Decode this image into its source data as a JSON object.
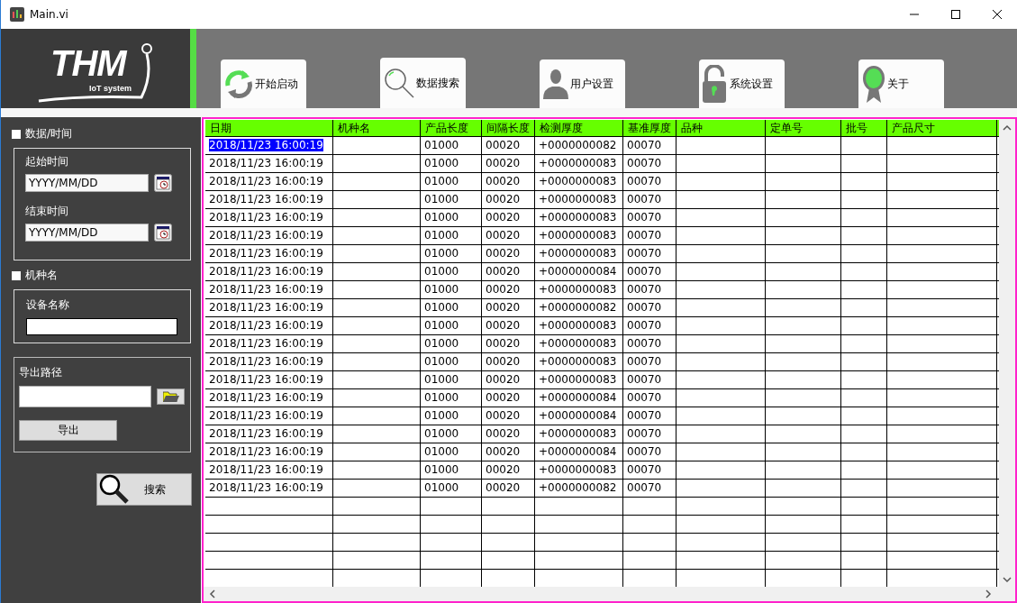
{
  "window": {
    "title": "Main.vi"
  },
  "logo": {
    "name": "THM",
    "tagline": "IoT system"
  },
  "tabs": [
    {
      "label": "开始启动",
      "kind": "refresh",
      "selected": false
    },
    {
      "label": "数据搜索",
      "kind": "search",
      "selected": true
    },
    {
      "label": "用户设置",
      "kind": "user",
      "selected": false
    },
    {
      "label": "系统设置",
      "kind": "lock",
      "selected": false
    },
    {
      "label": "关于",
      "kind": "award",
      "selected": false
    }
  ],
  "filters": {
    "date_filter": {
      "label": "数据/时间",
      "checked": false
    },
    "start_time": {
      "label": "起始时间",
      "value": "YYYY/MM/DD"
    },
    "end_time": {
      "label": "结束时间",
      "value": "YYYY/MM/DD"
    },
    "model_filter": {
      "label": "机种名",
      "checked": false
    },
    "device_name": {
      "label": "设备名称"
    },
    "export_path": {
      "label": "导出路径"
    },
    "export_button": "导出",
    "search_button": "搜索"
  },
  "table": {
    "columns": [
      "日期",
      "机种名",
      "产品长度",
      "间隔长度",
      "检测厚度",
      "基准厚度",
      "品种",
      "定单号",
      "批号",
      "产品尺寸"
    ],
    "rows": [
      {
        "selected": true,
        "cells": [
          "2018/11/23 16:00:19",
          "",
          "01000",
          "00020",
          "+0000000082",
          "00070",
          "",
          "",
          "",
          ""
        ]
      },
      {
        "selected": false,
        "cells": [
          "2018/11/23 16:00:19",
          "",
          "01000",
          "00020",
          "+0000000083",
          "00070",
          "",
          "",
          "",
          ""
        ]
      },
      {
        "selected": false,
        "cells": [
          "2018/11/23 16:00:19",
          "",
          "01000",
          "00020",
          "+0000000083",
          "00070",
          "",
          "",
          "",
          ""
        ]
      },
      {
        "selected": false,
        "cells": [
          "2018/11/23 16:00:19",
          "",
          "01000",
          "00020",
          "+0000000083",
          "00070",
          "",
          "",
          "",
          ""
        ]
      },
      {
        "selected": false,
        "cells": [
          "2018/11/23 16:00:19",
          "",
          "01000",
          "00020",
          "+0000000083",
          "00070",
          "",
          "",
          "",
          ""
        ]
      },
      {
        "selected": false,
        "cells": [
          "2018/11/23 16:00:19",
          "",
          "01000",
          "00020",
          "+0000000083",
          "00070",
          "",
          "",
          "",
          ""
        ]
      },
      {
        "selected": false,
        "cells": [
          "2018/11/23 16:00:19",
          "",
          "01000",
          "00020",
          "+0000000083",
          "00070",
          "",
          "",
          "",
          ""
        ]
      },
      {
        "selected": false,
        "cells": [
          "2018/11/23 16:00:19",
          "",
          "01000",
          "00020",
          "+0000000084",
          "00070",
          "",
          "",
          "",
          ""
        ]
      },
      {
        "selected": false,
        "cells": [
          "2018/11/23 16:00:19",
          "",
          "01000",
          "00020",
          "+0000000083",
          "00070",
          "",
          "",
          "",
          ""
        ]
      },
      {
        "selected": false,
        "cells": [
          "2018/11/23 16:00:19",
          "",
          "01000",
          "00020",
          "+0000000082",
          "00070",
          "",
          "",
          "",
          ""
        ]
      },
      {
        "selected": false,
        "cells": [
          "2018/11/23 16:00:19",
          "",
          "01000",
          "00020",
          "+0000000083",
          "00070",
          "",
          "",
          "",
          ""
        ]
      },
      {
        "selected": false,
        "cells": [
          "2018/11/23 16:00:19",
          "",
          "01000",
          "00020",
          "+0000000083",
          "00070",
          "",
          "",
          "",
          ""
        ]
      },
      {
        "selected": false,
        "cells": [
          "2018/11/23 16:00:19",
          "",
          "01000",
          "00020",
          "+0000000083",
          "00070",
          "",
          "",
          "",
          ""
        ]
      },
      {
        "selected": false,
        "cells": [
          "2018/11/23 16:00:19",
          "",
          "01000",
          "00020",
          "+0000000083",
          "00070",
          "",
          "",
          "",
          ""
        ]
      },
      {
        "selected": false,
        "cells": [
          "2018/11/23 16:00:19",
          "",
          "01000",
          "00020",
          "+0000000084",
          "00070",
          "",
          "",
          "",
          ""
        ]
      },
      {
        "selected": false,
        "cells": [
          "2018/11/23 16:00:19",
          "",
          "01000",
          "00020",
          "+0000000084",
          "00070",
          "",
          "",
          "",
          ""
        ]
      },
      {
        "selected": false,
        "cells": [
          "2018/11/23 16:00:19",
          "",
          "01000",
          "00020",
          "+0000000083",
          "00070",
          "",
          "",
          "",
          ""
        ]
      },
      {
        "selected": false,
        "cells": [
          "2018/11/23 16:00:19",
          "",
          "01000",
          "00020",
          "+0000000084",
          "00070",
          "",
          "",
          "",
          ""
        ]
      },
      {
        "selected": false,
        "cells": [
          "2018/11/23 16:00:19",
          "",
          "01000",
          "00020",
          "+0000000083",
          "00070",
          "",
          "",
          "",
          ""
        ]
      },
      {
        "selected": false,
        "cells": [
          "2018/11/23 16:00:19",
          "",
          "01000",
          "00020",
          "+0000000082",
          "00070",
          "",
          "",
          "",
          ""
        ]
      }
    ]
  }
}
